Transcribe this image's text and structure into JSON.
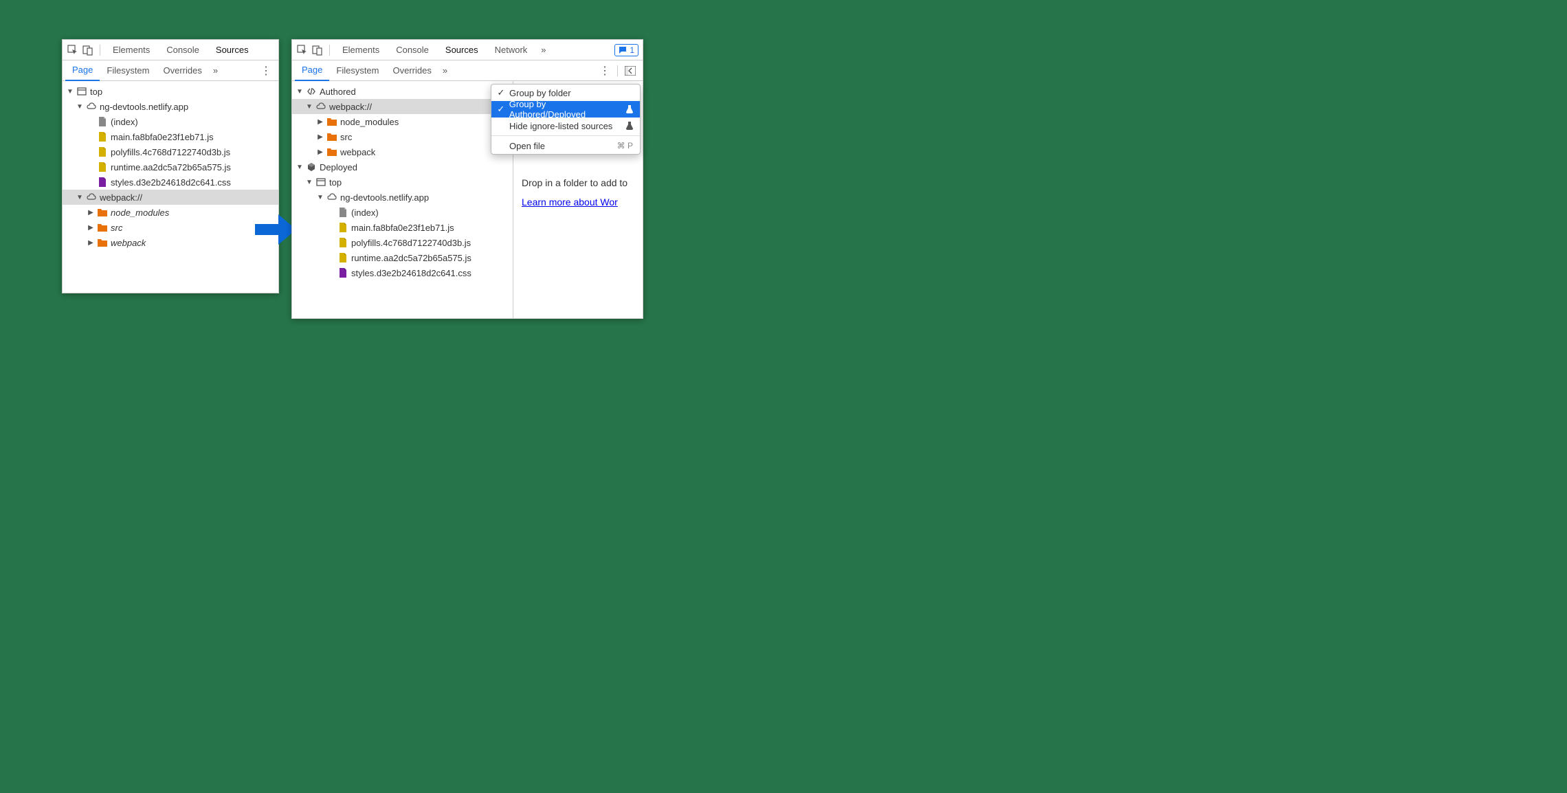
{
  "toolbar_tabs": {
    "elements": "Elements",
    "console": "Console",
    "sources": "Sources",
    "network": "Network"
  },
  "subtabs": {
    "page": "Page",
    "filesystem": "Filesystem",
    "overrides": "Overrides"
  },
  "issue_count": "1",
  "left_tree": {
    "top": "top",
    "domain": "ng-devtools.netlify.app",
    "index": "(index)",
    "main_js": "main.fa8bfa0e23f1eb71.js",
    "polyfills_js": "polyfills.4c768d7122740d3b.js",
    "runtime_js": "runtime.aa2dc5a72b65a575.js",
    "styles_css": "styles.d3e2b24618d2c641.css",
    "webpack": "webpack://",
    "node_modules": "node_modules",
    "src": "src",
    "webpack_folder": "webpack"
  },
  "right_tree": {
    "authored": "Authored",
    "webpack": "webpack://",
    "node_modules": "node_modules",
    "src": "src",
    "webpack_folder": "webpack",
    "deployed": "Deployed",
    "top": "top",
    "domain": "ng-devtools.netlify.app",
    "index": "(index)",
    "main_js": "main.fa8bfa0e23f1eb71.js",
    "polyfills_js": "polyfills.4c768d7122740d3b.js",
    "runtime_js": "runtime.aa2dc5a72b65a575.js",
    "styles_css": "styles.d3e2b24618d2c641.css"
  },
  "menu": {
    "group_folder": "Group by folder",
    "group_authored": "Group by Authored/Deployed",
    "hide_ignore": "Hide ignore-listed sources",
    "open_file": "Open file",
    "open_file_shortcut": "⌘ P"
  },
  "right_pane": {
    "drop_text": "Drop in a folder to add to",
    "learn_more": "Learn more about Wor"
  }
}
